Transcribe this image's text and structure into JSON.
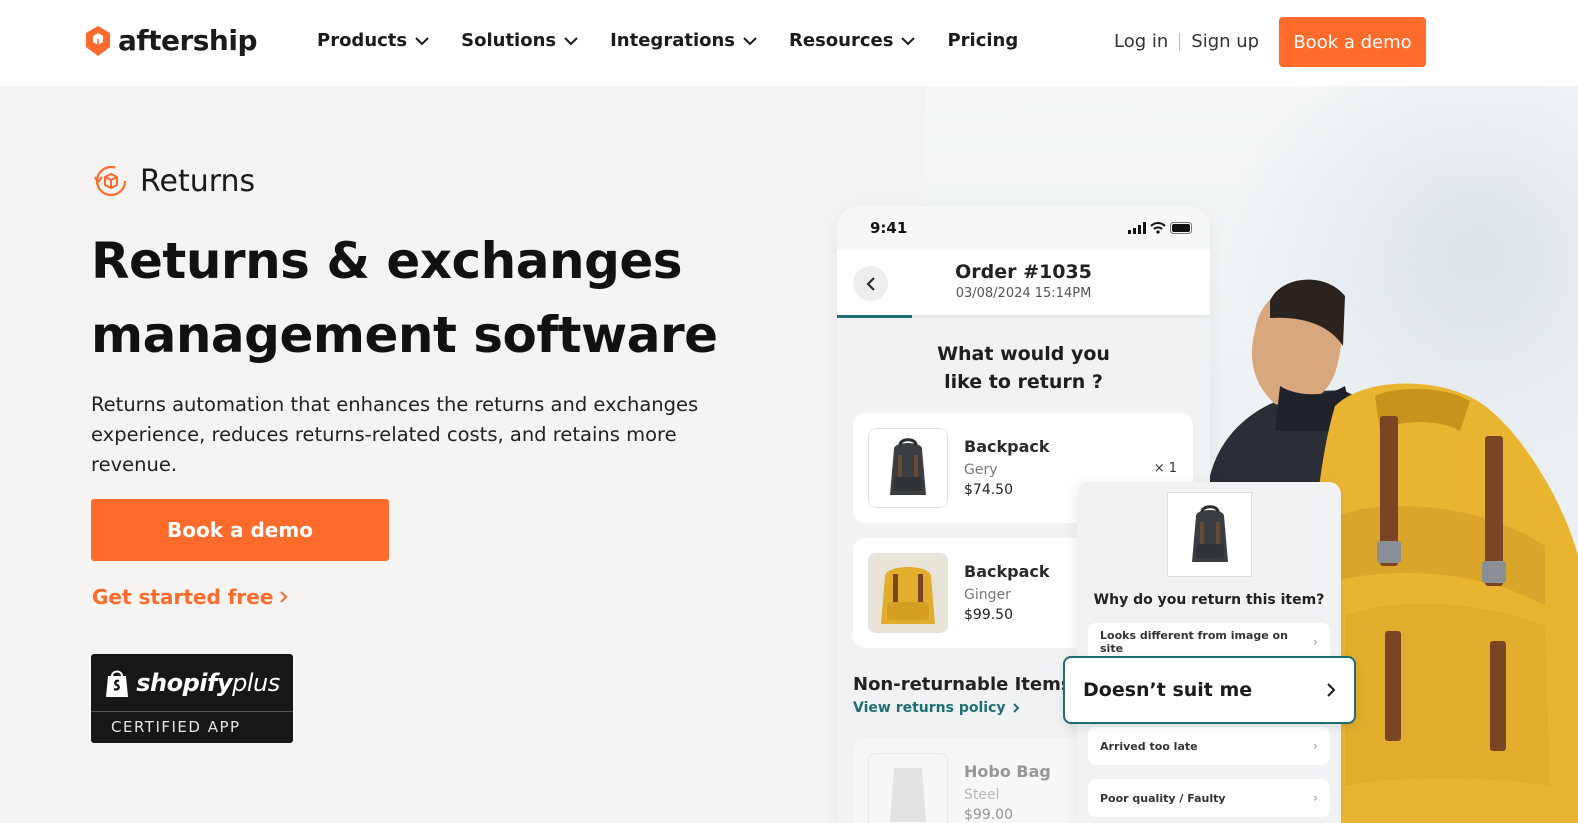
{
  "brand": {
    "name": "aftership",
    "accent": "#ff6b2b",
    "teal": "#1e6e74"
  },
  "nav": {
    "items": [
      {
        "label": "Products",
        "dropdown": true
      },
      {
        "label": "Solutions",
        "dropdown": true
      },
      {
        "label": "Integrations",
        "dropdown": true
      },
      {
        "label": "Resources",
        "dropdown": true
      },
      {
        "label": "Pricing",
        "dropdown": false
      }
    ],
    "login": "Log in",
    "signup": "Sign up",
    "cta": "Book a demo"
  },
  "hero": {
    "eyebrow": "Returns",
    "headline_line1": "Returns & exchanges",
    "headline_line2": "management software",
    "subcopy": "Returns automation that enhances the returns and exchanges experience, reduces returns-related costs, and retains more revenue.",
    "cta": "Book a demo",
    "secondary_link": "Get started free",
    "badge": {
      "brand_bold": "shopify",
      "brand_light": "plus",
      "caption": "CERTIFIED APP"
    }
  },
  "phone": {
    "time": "9:41",
    "order_title": "Order #1035",
    "order_date": "03/08/2024 15:14PM",
    "progress": 0.2,
    "question_line1": "What would you",
    "question_line2": "like to return ?",
    "items": [
      {
        "name": "Backpack",
        "variant": "Gery",
        "price": "$74.50",
        "qty": "× 1"
      },
      {
        "name": "Backpack",
        "variant": "Ginger",
        "price": "$99.50"
      }
    ],
    "non_returnable_title": "Non-returnable Items",
    "policy_link": "View returns policy",
    "non_returnable_item": {
      "name": "Hobo Bag",
      "variant": "Steel",
      "price": "$99.00"
    }
  },
  "reason_panel": {
    "question": "Why do you return this item?",
    "options": [
      "Looks different from image on site",
      "Arrived too late",
      "Poor quality / Faulty"
    ],
    "selected": "Doesn’t suit me"
  }
}
